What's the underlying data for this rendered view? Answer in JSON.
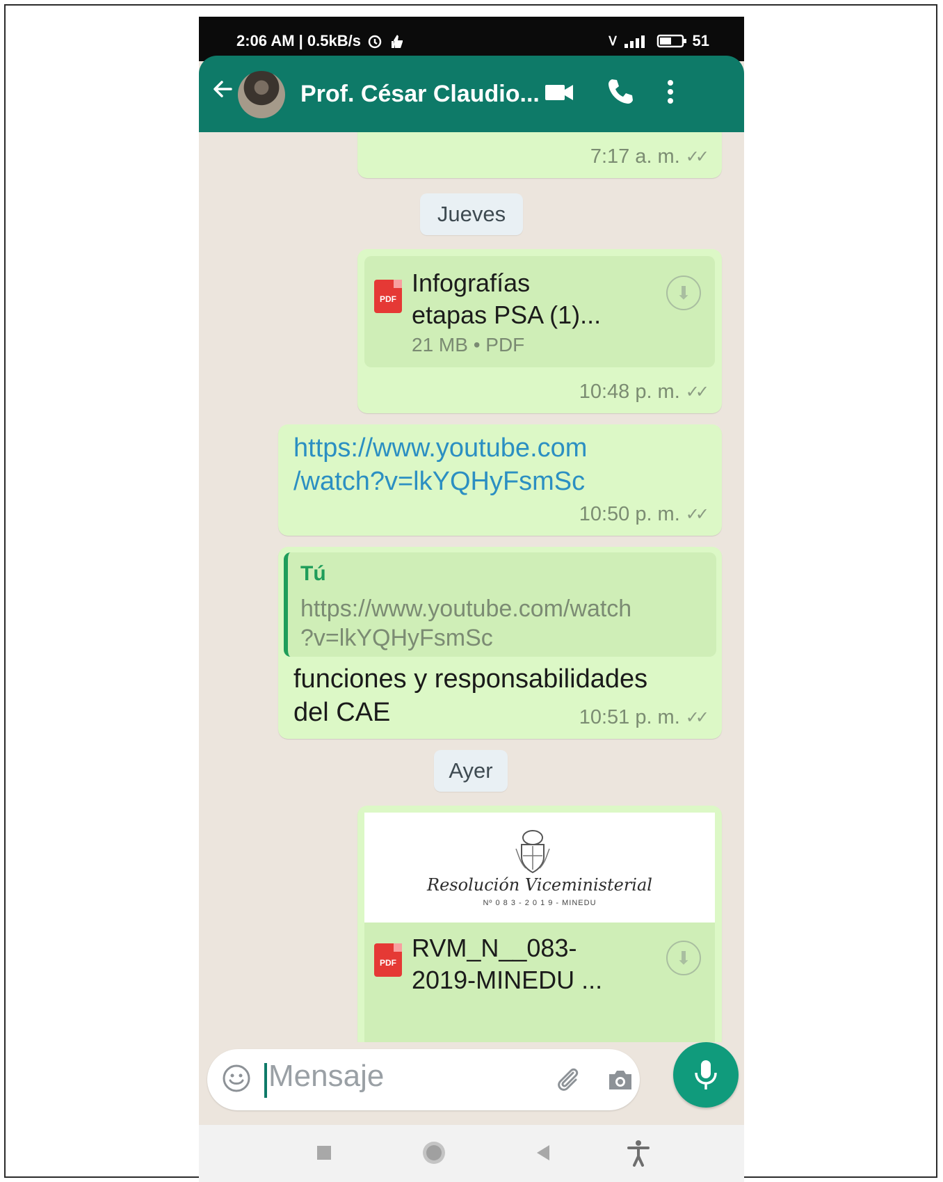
{
  "status_bar": {
    "left_text": "2:06 AM | 0.5kB/s",
    "battery": "51"
  },
  "header": {
    "contact_name": "Prof. César Claudio...",
    "icons": [
      "back-arrow-icon",
      "video-call-icon",
      "phone-call-icon",
      "more-options-icon"
    ]
  },
  "messages": [
    {
      "kind": "partial",
      "time": "7:17 a. m."
    },
    {
      "kind": "date",
      "label": "Jueves"
    },
    {
      "kind": "document",
      "name_line1": "Infografías",
      "name_line2": "etapas PSA (1)...",
      "meta": "21 MB • PDF",
      "time": "10:48 p. m."
    },
    {
      "kind": "link",
      "line1": "https://www.youtube.com",
      "line2": "/watch?v=lkYQHyFsmSc",
      "time": "10:50 p. m."
    },
    {
      "kind": "reply",
      "quote_author": "Tú",
      "quote_line1": "https://www.youtube.com/watch",
      "quote_line2": "?v=lkYQHyFsmSc",
      "text_line1": "funciones y responsabilidades",
      "text_line2": "del CAE",
      "time": "10:51 p. m."
    },
    {
      "kind": "date",
      "label": "Ayer"
    },
    {
      "kind": "document",
      "preview_title": "Resolución Viceministerial",
      "preview_subtitle": "Nº 0 8 3 - 2 0 1 9 - MINEDU",
      "name_line1": "RVM_N__083-",
      "name_line2": "2019-MINEDU ..."
    }
  ],
  "composer": {
    "placeholder": "Mensaje"
  },
  "colors": {
    "header": "#0e7a68",
    "outgoing_bubble": "#dcf8c6",
    "chat_background": "#ece5dd",
    "mic_button": "#109b7c",
    "link": "#2b8fc2"
  }
}
